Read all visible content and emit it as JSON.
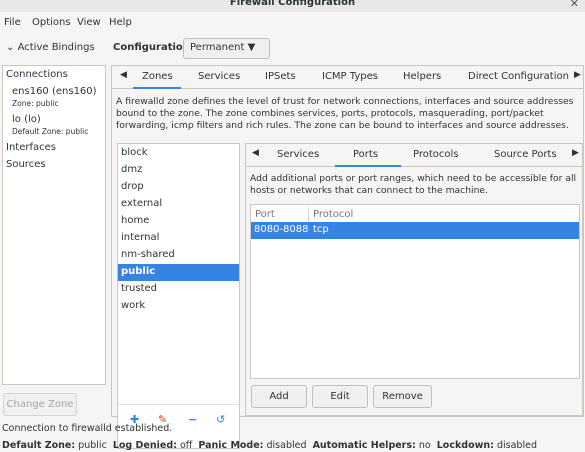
{
  "window": {
    "title": "Firewall Configuration"
  },
  "menu": [
    "File",
    "Options",
    "View",
    "Help"
  ],
  "bindings": {
    "label": "Active Bindings",
    "chevron": "chevron-down-icon"
  },
  "config": {
    "label": "Configuration:",
    "value": "Permanent"
  },
  "left": {
    "connections": "Connections",
    "conn1_name": "ens160 (ens160)",
    "conn1_zone": "Zone: public",
    "conn2_name": "lo (lo)",
    "conn2_zone": "Default Zone: public",
    "interfaces": "Interfaces",
    "sources": "Sources",
    "change_zone": "Change Zone"
  },
  "main_tabs": [
    "Zones",
    "Services",
    "IPSets",
    "ICMP Types",
    "Helpers",
    "Direct Configuration"
  ],
  "zones_description": "A firewalld zone defines the level of trust for network connections, interfaces and source addresses bound to the zone. The zone combines services, ports, protocols, masquerading, port/packet forwarding, icmp filters and rich rules. The zone can be bound to interfaces and source addresses.",
  "zones": [
    "block",
    "dmz",
    "drop",
    "external",
    "home",
    "internal",
    "nm-shared",
    "public",
    "trusted",
    "work"
  ],
  "selected_zone": "public",
  "sub_tabs": [
    "Services",
    "Ports",
    "Protocols",
    "Source Ports"
  ],
  "ports_description": "Add additional ports or port ranges, which need to be accessible for all hosts or networks that can connect to the machine.",
  "port_table": {
    "headers": [
      "Port",
      "Protocol"
    ],
    "rows": [
      {
        "port": "8080-8088",
        "protocol": "tcp"
      }
    ]
  },
  "buttons": {
    "add": "Add",
    "edit": "Edit",
    "remove": "Remove"
  },
  "status": {
    "line1": "Connection to firewalld established.",
    "default_zone_label": "Default Zone:",
    "default_zone": "public",
    "log_denied_label": "Log Denied:",
    "log_denied": "off",
    "panic_label": "Panic Mode:",
    "panic": "disabled",
    "helpers_label": "Automatic Helpers:",
    "helpers": "no",
    "lockdown_label": "Lockdown:",
    "lockdown": "disabled"
  },
  "colors": {
    "accent": "#3584e4",
    "background": "#f6f5f4"
  }
}
